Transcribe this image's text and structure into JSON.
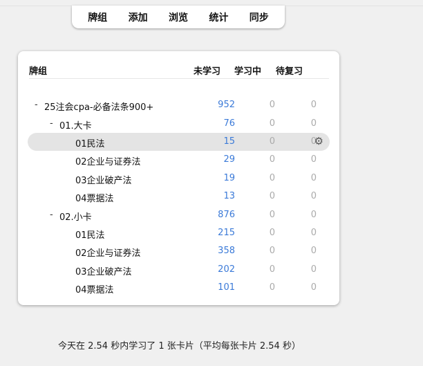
{
  "toolbar": {
    "items": [
      "牌组",
      "添加",
      "浏览",
      "统计",
      "同步"
    ]
  },
  "table": {
    "headers": {
      "deck": "牌组",
      "new": "未学习",
      "learning": "学习中",
      "due": "待复习"
    },
    "rows": [
      {
        "expander": "-",
        "name": "25注会cpa-必备法条900+",
        "new": "952",
        "learn": "0",
        "due": "0"
      },
      {
        "expander": "-",
        "name": "01.大卡",
        "new": "76",
        "learn": "0",
        "due": "0"
      },
      {
        "expander": "",
        "name": "01民法",
        "new": "15",
        "learn": "0",
        "due": "0",
        "current": true
      },
      {
        "expander": "",
        "name": "02企业与证券法",
        "new": "29",
        "learn": "0",
        "due": "0"
      },
      {
        "expander": "",
        "name": "03企业破产法",
        "new": "19",
        "learn": "0",
        "due": "0"
      },
      {
        "expander": "",
        "name": "04票据法",
        "new": "13",
        "learn": "0",
        "due": "0"
      },
      {
        "expander": "-",
        "name": "02.小卡",
        "new": "876",
        "learn": "0",
        "due": "0"
      },
      {
        "expander": "",
        "name": "01民法",
        "new": "215",
        "learn": "0",
        "due": "0"
      },
      {
        "expander": "",
        "name": "02企业与证券法",
        "new": "358",
        "learn": "0",
        "due": "0"
      },
      {
        "expander": "",
        "name": "03企业破产法",
        "new": "202",
        "learn": "0",
        "due": "0"
      },
      {
        "expander": "",
        "name": "04票据法",
        "new": "101",
        "learn": "0",
        "due": "0"
      }
    ]
  },
  "gear_icon": "gear-icon",
  "colors": {
    "new": "#3b7ad8",
    "zero": "#aaaaaa",
    "highlight": "#e4e4e4"
  },
  "footer": {
    "text": "今天在 2.54 秒内学习了 1 张卡片（平均每张卡片 2.54 秒）"
  }
}
